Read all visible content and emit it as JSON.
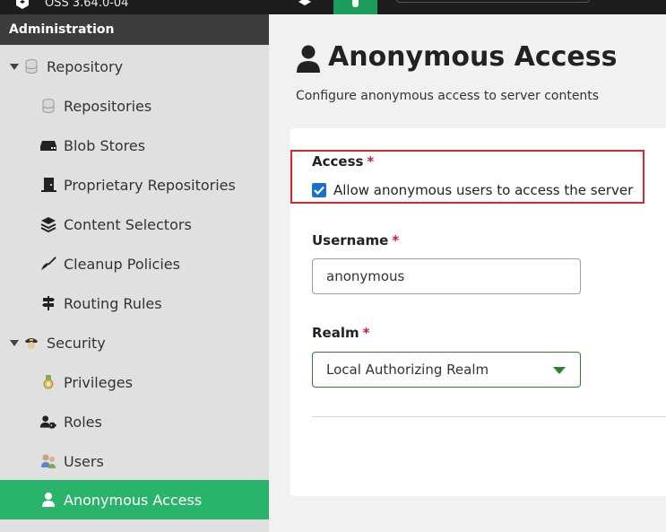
{
  "topbar": {
    "version": "OSS 3.64.0-04"
  },
  "sidebar": {
    "header": "Administration",
    "items": [
      {
        "label": "Repository",
        "icon": "database-icon"
      },
      {
        "label": "Repositories",
        "icon": "database-icon"
      },
      {
        "label": "Blob Stores",
        "icon": "hard-drive-icon"
      },
      {
        "label": "Proprietary Repositories",
        "icon": "door-icon"
      },
      {
        "label": "Content Selectors",
        "icon": "layers-icon"
      },
      {
        "label": "Cleanup Policies",
        "icon": "broom-icon"
      },
      {
        "label": "Routing Rules",
        "icon": "signpost-icon"
      },
      {
        "label": "Security",
        "icon": "police-badge-icon"
      },
      {
        "label": "Privileges",
        "icon": "medal-icon"
      },
      {
        "label": "Roles",
        "icon": "user-tag-icon"
      },
      {
        "label": "Users",
        "icon": "users-icon"
      },
      {
        "label": "Anonymous Access",
        "icon": "user-icon"
      }
    ],
    "active_item": "Anonymous Access"
  },
  "main": {
    "title": "Anonymous Access",
    "subtitle": "Configure anonymous access to server contents",
    "access": {
      "label": "Access",
      "required_marker": "*",
      "checkbox_label": "Allow anonymous users to access the server",
      "checked": true
    },
    "username": {
      "label": "Username",
      "required_marker": "*",
      "value": "anonymous"
    },
    "realm": {
      "label": "Realm",
      "required_marker": "*",
      "value": "Local Authorizing Realm"
    }
  },
  "colors": {
    "accent": "#2ab36a",
    "highlight_border": "#d9272e",
    "required": "#c2185b",
    "checkbox": "#1a6fc9",
    "select_border": "#2e7d32"
  }
}
